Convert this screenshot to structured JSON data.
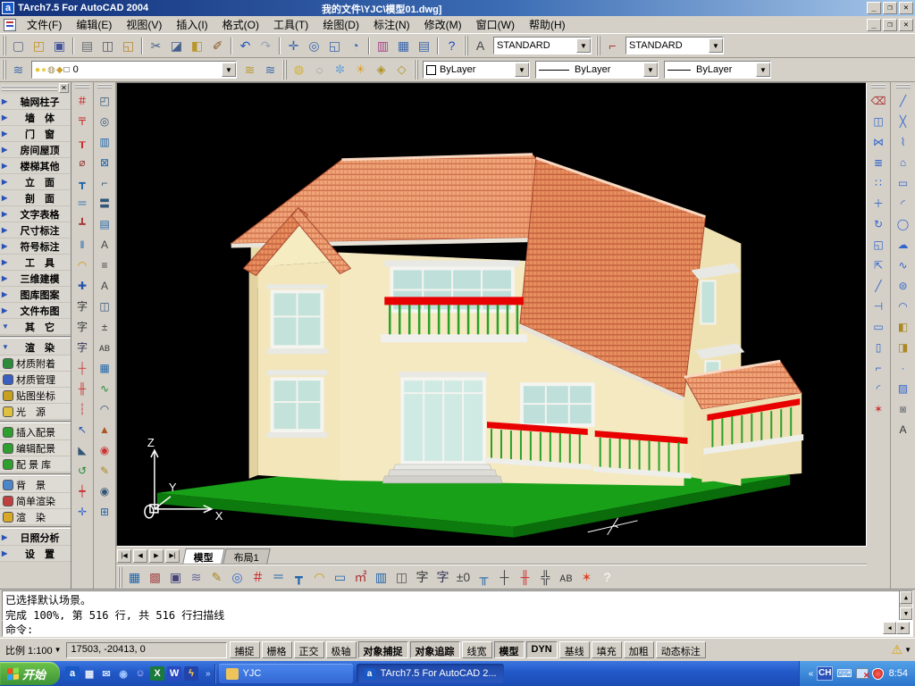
{
  "window": {
    "app_icon_letter": "a",
    "title": "TArch7.5 For AutoCAD 2004",
    "document_title": "我的文件\\YJC\\模型01.dwg]"
  },
  "menu": {
    "items": [
      "文件(F)",
      "编辑(E)",
      "视图(V)",
      "插入(I)",
      "格式(O)",
      "工具(T)",
      "绘图(D)",
      "标注(N)",
      "修改(M)",
      "窗口(W)",
      "帮助(H)"
    ]
  },
  "toolbar1": {
    "icons": [
      {
        "name": "new-file-icon",
        "glyph": "▢",
        "color": "#5a6a8a"
      },
      {
        "name": "open-file-icon",
        "glyph": "◰",
        "color": "#c89020"
      },
      {
        "name": "save-icon",
        "glyph": "▣",
        "color": "#44549a"
      },
      {
        "sep": true
      },
      {
        "name": "print-icon",
        "glyph": "▤",
        "color": "#666a70"
      },
      {
        "name": "print-preview-icon",
        "glyph": "◫",
        "color": "#556"
      },
      {
        "name": "plot-icon",
        "glyph": "◱",
        "color": "#b8862a"
      },
      {
        "sep": true
      },
      {
        "name": "cut-icon",
        "glyph": "✂",
        "color": "#44608a"
      },
      {
        "name": "copy-icon",
        "glyph": "◪",
        "color": "#44608a"
      },
      {
        "name": "paste-icon",
        "glyph": "◧",
        "color": "#b8962a"
      },
      {
        "name": "matchprop-icon",
        "glyph": "✐",
        "color": "#8a5a2a"
      },
      {
        "sep": true
      },
      {
        "name": "undo-icon",
        "glyph": "↶",
        "color": "#2255bb"
      },
      {
        "name": "redo-icon",
        "glyph": "↷",
        "color": "#9aa4b4"
      },
      {
        "sep": true
      },
      {
        "name": "pan-icon",
        "glyph": "✛",
        "color": "#3a66aa"
      },
      {
        "name": "zoom-realtime-icon",
        "glyph": "◎",
        "color": "#3a66aa"
      },
      {
        "name": "zoom-window-icon",
        "glyph": "◱",
        "color": "#3a66aa"
      },
      {
        "name": "zoom-previous-icon",
        "glyph": "◔",
        "color": "#3a66aa"
      },
      {
        "sep": true
      },
      {
        "name": "quick-select-icon",
        "glyph": "▥",
        "color": "#aa4488"
      },
      {
        "name": "design-center-icon",
        "glyph": "▦",
        "color": "#3a66aa"
      },
      {
        "name": "properties-icon",
        "glyph": "▤",
        "color": "#3a66aa"
      },
      {
        "sep": true
      },
      {
        "name": "help-icon",
        "glyph": "?",
        "color": "#1a4ac0"
      }
    ],
    "text_style_label": "STANDARD",
    "dim_style_label": "STANDARD"
  },
  "toolbar2": {
    "layers_icon": {
      "name": "layer-manager-icon",
      "glyph": "≋",
      "color": "#3a66aa"
    },
    "layer_combo": {
      "icons": [
        {
          "name": "layer-bulb-icon",
          "glyph": "●",
          "color": "#e8c428"
        },
        {
          "name": "layer-sun-icon",
          "glyph": "●",
          "color": "#e8d060"
        },
        {
          "name": "layer-plot-icon",
          "glyph": "◍",
          "color": "#9a8a50"
        },
        {
          "name": "layer-lock-icon",
          "glyph": "◆",
          "color": "#c8a030"
        },
        {
          "name": "layer-color-swatch",
          "glyph": "□",
          "color": "#222"
        }
      ],
      "value": "0"
    },
    "layer_buttons": [
      {
        "name": "make-layer-current-icon",
        "glyph": "≋",
        "color": "#b8962a"
      },
      {
        "name": "layer-previous-icon",
        "glyph": "≋",
        "color": "#3a66aa"
      }
    ],
    "layer_tools": [
      {
        "name": "layer-on-icon",
        "glyph": "◍",
        "color": "#d8b020"
      },
      {
        "name": "layer-off-icon",
        "glyph": "◌",
        "color": "#778"
      },
      {
        "name": "layer-freeze-icon",
        "glyph": "✼",
        "color": "#66a0d8"
      },
      {
        "name": "layer-thaw-icon",
        "glyph": "☀",
        "color": "#e0a020"
      },
      {
        "name": "layer-lock2-icon",
        "glyph": "◈",
        "color": "#b09020"
      },
      {
        "name": "layer-unlock-icon",
        "glyph": "◇",
        "color": "#b09020"
      }
    ],
    "color_value": "ByLayer",
    "linetype_value": "ByLayer",
    "lineweight_value": "ByLayer"
  },
  "sidebar": {
    "menus": [
      {
        "label": "轴网柱子",
        "expanded": false
      },
      {
        "label": "墙　体",
        "expanded": false
      },
      {
        "label": "门　窗",
        "expanded": false
      },
      {
        "label": "房间屋顶",
        "expanded": false
      },
      {
        "label": "楼梯其他",
        "expanded": false
      },
      {
        "label": "立　面",
        "expanded": false
      },
      {
        "label": "剖　面",
        "expanded": false
      },
      {
        "label": "文字表格",
        "expanded": false
      },
      {
        "label": "尺寸标注",
        "expanded": false
      },
      {
        "label": "符号标注",
        "expanded": false
      },
      {
        "label": "工　具",
        "expanded": false
      },
      {
        "label": "三维建模",
        "expanded": false
      },
      {
        "label": "图库图案",
        "expanded": false
      },
      {
        "label": "文件布图",
        "expanded": false
      },
      {
        "label": "其　它",
        "expanded": true
      }
    ],
    "render_header": {
      "label": "渲　染",
      "expanded": true
    },
    "render_items_a": [
      {
        "label": "材质附着",
        "name": "material-attach-item",
        "chip": "#2e8b3a"
      },
      {
        "label": "材质管理",
        "name": "material-manage-item",
        "chip": "#3a5fc0"
      },
      {
        "label": "贴图坐标",
        "name": "mapping-coords-item",
        "chip": "#c8a020"
      },
      {
        "label": "光　源",
        "name": "light-source-item",
        "chip": "#e0c040"
      }
    ],
    "render_items_b": [
      {
        "label": "插入配景",
        "name": "insert-scenery-item",
        "chip": "#2e9e2e"
      },
      {
        "label": "编辑配景",
        "name": "edit-scenery-item",
        "chip": "#2e9e2e"
      },
      {
        "label": "配 景 库",
        "name": "scenery-library-item",
        "chip": "#2e9e2e"
      }
    ],
    "render_items_c": [
      {
        "label": "背　景",
        "name": "background-item",
        "chip": "#4a86c8"
      },
      {
        "label": "简单渲染",
        "name": "quick-render-item",
        "chip": "#c04040"
      },
      {
        "label": "渲　染",
        "name": "render-item",
        "chip": "#d8a828"
      }
    ],
    "bottom_menus": [
      {
        "label": "日照分析",
        "expanded": false
      },
      {
        "label": "设　置",
        "expanded": false
      }
    ]
  },
  "left_tools": {
    "col_a": [
      {
        "name": "axis-grid-icon",
        "glyph": "＃",
        "color": "#c22"
      },
      {
        "name": "axis-node-icon",
        "glyph": "〒",
        "color": "#c22"
      },
      {
        "name": "axis-label-icon",
        "glyph": "┰",
        "color": "#c22"
      },
      {
        "name": "arc-axis-icon",
        "glyph": "⌀",
        "color": "#933"
      },
      {
        "name": "wall-draw-icon",
        "glyph": "┳",
        "color": "#26a"
      },
      {
        "name": "wall-parallel-icon",
        "glyph": "＝",
        "color": "#26a"
      },
      {
        "name": "wall-base-icon",
        "glyph": "┻",
        "color": "#a33"
      },
      {
        "name": "wall-align-icon",
        "glyph": "‖",
        "color": "#26a"
      },
      {
        "name": "door-arc-icon",
        "glyph": "◠",
        "color": "#c90"
      },
      {
        "name": "column-cross-icon",
        "glyph": "✚",
        "color": "#25a"
      },
      {
        "name": "text-brush-icon",
        "glyph": "字",
        "color": "#333"
      },
      {
        "name": "text-icon",
        "glyph": "字",
        "color": "#333"
      },
      {
        "name": "text-lines-icon",
        "glyph": "字",
        "color": "#335"
      },
      {
        "name": "dim-axis-icon",
        "glyph": "┼",
        "color": "#c33"
      },
      {
        "name": "dim-two-icon",
        "glyph": "╫",
        "color": "#c33"
      },
      {
        "name": "dim-free-icon",
        "glyph": "┆",
        "color": "#c33"
      },
      {
        "name": "select-circle-icon",
        "glyph": "↖",
        "color": "#25a"
      },
      {
        "name": "slope-tool-icon",
        "glyph": "◣",
        "color": "#357"
      },
      {
        "name": "refresh-icon",
        "glyph": "↺",
        "color": "#283"
      },
      {
        "name": "dim-chain-icon",
        "glyph": "┿",
        "color": "#c33"
      },
      {
        "name": "move-xy-icon",
        "glyph": "✛",
        "color": "#36c"
      }
    ],
    "col_b": [
      {
        "name": "hand-edit-icon",
        "glyph": "◰",
        "color": "#357"
      },
      {
        "name": "magnifier-icon",
        "glyph": "◎",
        "color": "#357"
      },
      {
        "name": "column-grid-icon",
        "glyph": "▥",
        "color": "#26a"
      },
      {
        "name": "box-select-icon",
        "glyph": "⊠",
        "color": "#26a"
      },
      {
        "name": "pipe-icon",
        "glyph": "⌐",
        "color": "#357"
      },
      {
        "name": "floor-copy-icon",
        "glyph": "〓",
        "color": "#357"
      },
      {
        "name": "number-grid-icon",
        "glyph": "▤",
        "color": "#26a"
      },
      {
        "name": "ab-arrow-icon",
        "glyph": "A",
        "color": "#444"
      },
      {
        "name": "list-icon",
        "glyph": "≡",
        "color": "#444"
      },
      {
        "name": "a-left-icon",
        "glyph": "A",
        "color": "#444"
      },
      {
        "name": "page-copy-icon",
        "glyph": "◫",
        "color": "#357"
      },
      {
        "name": "tolerance-icon",
        "glyph": "±",
        "color": "#444"
      },
      {
        "name": "ab-eq-icon",
        "glyph": "ᴀʙ",
        "color": "#444"
      },
      {
        "name": "table-icon",
        "glyph": "▦",
        "color": "#26a"
      },
      {
        "name": "wave-icon",
        "glyph": "∿",
        "color": "#283"
      },
      {
        "name": "arch-door-icon",
        "glyph": "◠",
        "color": "#357"
      },
      {
        "name": "pavilion-icon",
        "glyph": "▲",
        "color": "#a52"
      },
      {
        "name": "red-eye-icon",
        "glyph": "◉",
        "color": "#c33"
      },
      {
        "name": "pencil-icon",
        "glyph": "✎",
        "color": "#a82"
      },
      {
        "name": "eye-icon",
        "glyph": "◉",
        "color": "#357"
      },
      {
        "name": "grid4-icon",
        "glyph": "⊞",
        "color": "#26a"
      }
    ]
  },
  "right_tools": {
    "modify": [
      {
        "name": "erase-icon",
        "glyph": "⌫",
        "color": "#a33"
      },
      {
        "name": "copy-object-icon",
        "glyph": "◫",
        "color": "#36c"
      },
      {
        "name": "mirror-icon",
        "glyph": "⋈",
        "color": "#36c"
      },
      {
        "name": "offset-icon",
        "glyph": "≣",
        "color": "#36c"
      },
      {
        "name": "array-icon",
        "glyph": "∷",
        "color": "#36c"
      },
      {
        "name": "move-icon",
        "glyph": "＋",
        "color": "#36c"
      },
      {
        "name": "rotate-icon",
        "glyph": "↻",
        "color": "#36c"
      },
      {
        "name": "scale-icon",
        "glyph": "◱",
        "color": "#36c"
      },
      {
        "name": "stretch-icon",
        "glyph": "⇱",
        "color": "#36c"
      },
      {
        "name": "trim-icon",
        "glyph": "╱",
        "color": "#36c"
      },
      {
        "name": "extend-icon",
        "glyph": "⊣",
        "color": "#36c"
      },
      {
        "name": "break-point-icon",
        "glyph": "▭",
        "color": "#36c"
      },
      {
        "name": "break-icon",
        "glyph": "▯",
        "color": "#36c"
      },
      {
        "name": "chamfer-icon",
        "glyph": "⌐",
        "color": "#36c"
      },
      {
        "name": "fillet-icon",
        "glyph": "◜",
        "color": "#36c"
      },
      {
        "name": "explode-icon",
        "glyph": "✶",
        "color": "#c33"
      }
    ],
    "draw": [
      {
        "name": "line-icon",
        "glyph": "╱",
        "color": "#36c"
      },
      {
        "name": "xline-icon",
        "glyph": "╳",
        "color": "#36c"
      },
      {
        "name": "polyline-icon",
        "glyph": "⌇",
        "color": "#36c"
      },
      {
        "name": "polygon-icon",
        "glyph": "⌂",
        "color": "#36c"
      },
      {
        "name": "rectangle-icon",
        "glyph": "▭",
        "color": "#36c"
      },
      {
        "name": "arc-icon",
        "glyph": "◜",
        "color": "#36c"
      },
      {
        "name": "circle-icon",
        "glyph": "◯",
        "color": "#36c"
      },
      {
        "name": "revcloud-icon",
        "glyph": "☁",
        "color": "#36c"
      },
      {
        "name": "spline-icon",
        "glyph": "∿",
        "color": "#36c"
      },
      {
        "name": "ellipse-icon",
        "glyph": "⊜",
        "color": "#36c"
      },
      {
        "name": "ellipse-arc-icon",
        "glyph": "◠",
        "color": "#36c"
      },
      {
        "name": "insert-block-icon",
        "glyph": "◧",
        "color": "#a82"
      },
      {
        "name": "make-block-icon",
        "glyph": "◨",
        "color": "#a82"
      },
      {
        "name": "point-icon",
        "glyph": "·",
        "color": "#36c"
      },
      {
        "name": "hatch-icon",
        "glyph": "▨",
        "color": "#36c"
      },
      {
        "name": "region-icon",
        "glyph": "◙",
        "color": "#888"
      },
      {
        "name": "text-a-icon",
        "glyph": "A",
        "color": "#333"
      }
    ]
  },
  "viewport": {
    "ucs": {
      "x": "X",
      "y": "Y",
      "z": "Z"
    },
    "house_colors": {
      "roof": "#f0a478",
      "roof_line": "#c05a38",
      "roof_dark": "#e88f60",
      "wall": "#f4e9c0",
      "wall_shade": "#e2d2a0",
      "lawn": "#19a019",
      "lawn_side": "#0c7a0c",
      "rail": "#e80000",
      "baluster": "#2aa02a",
      "glass": "#c2e2da",
      "frame": "#f4f4f0"
    }
  },
  "tabs": {
    "nav": [
      "|◀",
      "◀",
      "▶",
      "▶|"
    ],
    "items": [
      {
        "label": "模型",
        "active": true
      },
      {
        "label": "布局1",
        "active": false
      }
    ]
  },
  "bottombar": {
    "icons": [
      {
        "name": "table-grid-icon",
        "glyph": "▦",
        "color": "#26a"
      },
      {
        "name": "edit-table-icon",
        "glyph": "▩",
        "color": "#a55"
      },
      {
        "name": "save-slide-icon",
        "glyph": "▣",
        "color": "#447"
      },
      {
        "name": "layers2-icon",
        "glyph": "≋",
        "color": "#669"
      },
      {
        "name": "note-icon",
        "glyph": "✎",
        "color": "#a82"
      },
      {
        "name": "rings-icon",
        "glyph": "◎",
        "color": "#36c"
      },
      {
        "name": "axis2-icon",
        "glyph": "＃",
        "color": "#c22"
      },
      {
        "name": "wall2-icon",
        "glyph": "＝",
        "color": "#26a"
      },
      {
        "name": "wall-insert-icon",
        "glyph": "┳",
        "color": "#26a"
      },
      {
        "name": "door-icon",
        "glyph": "◠",
        "color": "#c90"
      },
      {
        "name": "window-icon",
        "glyph": "▭",
        "color": "#26a"
      },
      {
        "name": "area-icon",
        "glyph": "㎡",
        "color": "#a33"
      },
      {
        "name": "column2-icon",
        "glyph": "▥",
        "color": "#26a"
      },
      {
        "name": "book-icon",
        "glyph": "◫",
        "color": "#555"
      },
      {
        "name": "text2-icon",
        "glyph": "字",
        "color": "#333"
      },
      {
        "name": "text-box-icon",
        "glyph": "字",
        "color": "#335"
      },
      {
        "name": "dim-updown-icon",
        "glyph": "±0",
        "color": "#444"
      },
      {
        "name": "stair-icon",
        "glyph": "╥",
        "color": "#26a"
      },
      {
        "name": "dim-h-icon",
        "glyph": "┼",
        "color": "#444"
      },
      {
        "name": "dim-chain2-icon",
        "glyph": "╫",
        "color": "#c33"
      },
      {
        "name": "dim-batch-icon",
        "glyph": "╬",
        "color": "#444"
      },
      {
        "name": "label-ab-icon",
        "glyph": "ᴀʙ",
        "color": "#444"
      },
      {
        "name": "bomb-icon",
        "glyph": "✶",
        "color": "#d42"
      },
      {
        "name": "help2-icon",
        "glyph": "?",
        "color": "#fff"
      }
    ]
  },
  "command": {
    "history": [
      "已选择默认场景。",
      "完成 100%, 第 516 行, 共 516 行扫描线"
    ],
    "prompt": "命令:"
  },
  "status": {
    "scale_label": "比例 1:100",
    "coords": "17503,  -20413, 0",
    "toggles": [
      {
        "label": "捕捉",
        "on": false
      },
      {
        "label": "栅格",
        "on": false
      },
      {
        "label": "正交",
        "on": false
      },
      {
        "label": "极轴",
        "on": false
      },
      {
        "label": "对象捕捉",
        "on": true
      },
      {
        "label": "对象追踪",
        "on": true
      },
      {
        "label": "线宽",
        "on": false
      },
      {
        "label": "模型",
        "on": true
      },
      {
        "label": "DYN",
        "on": true
      },
      {
        "label": "基线",
        "on": false
      },
      {
        "label": "填充",
        "on": false
      },
      {
        "label": "加粗",
        "on": false
      },
      {
        "label": "动态标注",
        "on": false
      }
    ],
    "tray_icon": "⚠"
  },
  "taskbar": {
    "start_label": "开始",
    "quick_launch": [
      {
        "name": "tarch-quicklaunch-icon",
        "glyph": "a",
        "chip": "#1959c5",
        "fg": "#ffffff"
      },
      {
        "name": "grid-app-icon",
        "glyph": "▦",
        "chip": "",
        "fg": "#e8eef8"
      },
      {
        "name": "outlook-express-icon",
        "glyph": "✉",
        "chip": "",
        "fg": "#cfe0ff"
      },
      {
        "name": "media-app-icon",
        "glyph": "◉",
        "chip": "",
        "fg": "#9ec4ff"
      },
      {
        "name": "messenger-icon",
        "glyph": "☺",
        "chip": "",
        "fg": "#d8c6ff"
      },
      {
        "name": "excel-icon",
        "glyph": "X",
        "chip": "#1a7a3a",
        "fg": "#ffffff"
      },
      {
        "name": "word-icon",
        "glyph": "W",
        "chip": "#2a4ac0",
        "fg": "#ffffff"
      },
      {
        "name": "flashget-icon",
        "glyph": "ϟ",
        "chip": "#2244aa",
        "fg": "#ffd24a"
      }
    ],
    "overflow_chevron": "»",
    "tasks": [
      {
        "label": "YJC",
        "ic": "",
        "chip": "#edc35a",
        "active": false,
        "name": "task-yjc"
      },
      {
        "label": "TArch7.5 For AutoCAD 2...",
        "ic": "a",
        "chip": "#1959c5",
        "fg": "#fff",
        "active": true,
        "name": "task-tarch"
      }
    ],
    "tray": {
      "collapse_chevron": "«",
      "lang": "CH",
      "time": "8:54"
    }
  }
}
